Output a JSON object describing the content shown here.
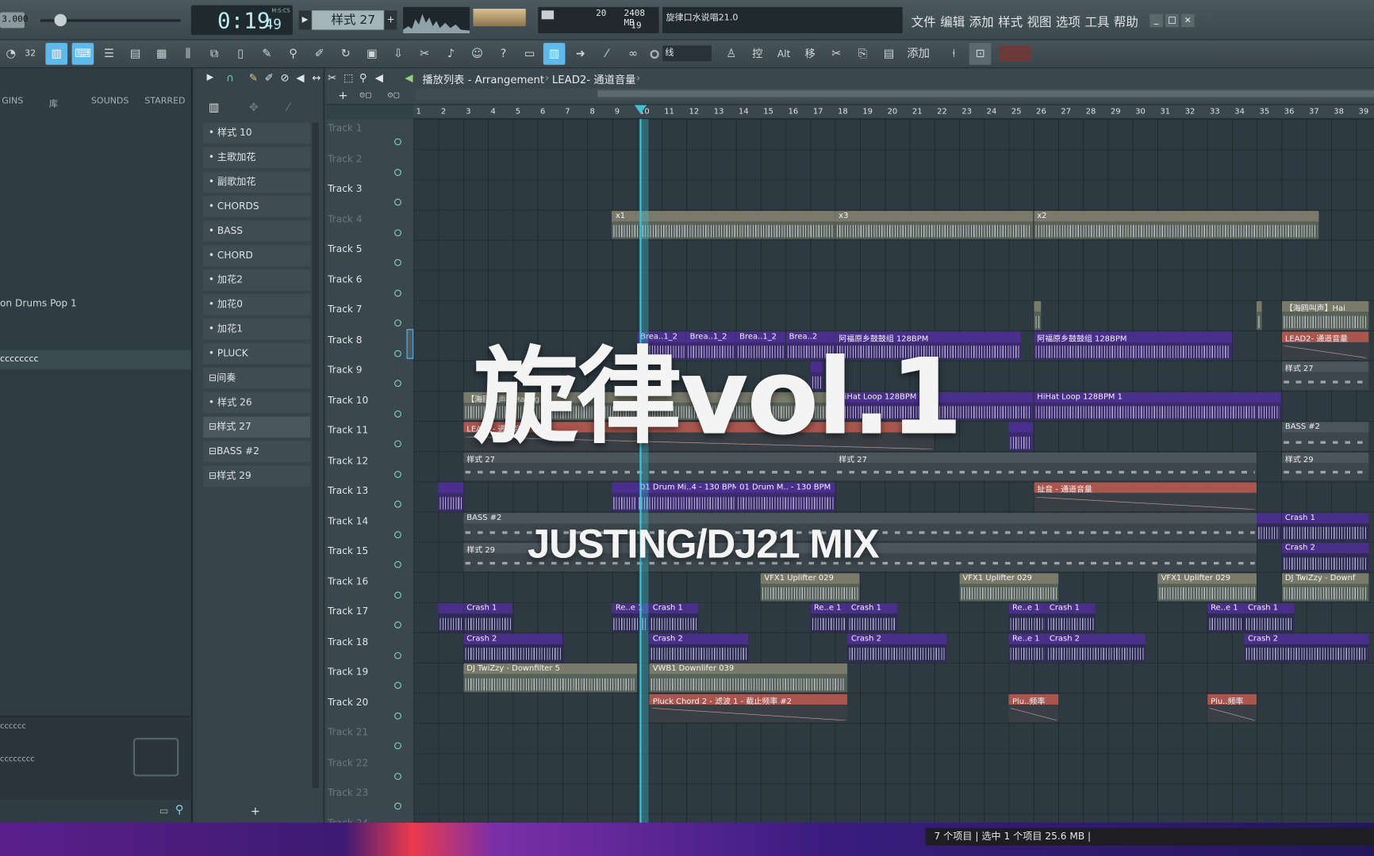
{
  "transport": {
    "pitch": "3.000",
    "time_main": "0:19",
    "time_sub": "49",
    "time_unit": "M:S:CS",
    "pattern": "样式 27"
  },
  "stats": {
    "cpu": "20",
    "ram": "2408 MB",
    "poly": "19"
  },
  "hint": "旋律口水说唱21.0",
  "menu": [
    "文件",
    "编辑",
    "添加",
    "样式",
    "视图",
    "选项",
    "工具",
    "帮助"
  ],
  "window_buttons": [
    "_",
    "□",
    "×"
  ],
  "toolbar": {
    "snap_label": "线",
    "icons": [
      "loop-icon",
      "counter-icon",
      "pattern-song-icon",
      "typing-icon",
      "mixer-icon",
      "channel-rack-icon",
      "playlist-icon",
      "piano-roll-icon",
      "plugin-icon",
      "browser-icon",
      "brush-icon",
      "metronome-icon",
      "pencil-icon",
      "save-icon",
      "render-icon",
      "cut-icon",
      "mic-icon",
      "chat-icon",
      "help-icon"
    ],
    "right_labels": [
      "控",
      "Alt",
      "移",
      "添加"
    ]
  },
  "breadcrumb": {
    "part1": "播放列表 - Arrangement",
    "part2": "LEAD2- 通道音量"
  },
  "browser": {
    "tabs": [
      "GINS",
      "库",
      "SOUNDS",
      "STARRED"
    ],
    "items": [
      {
        "label": "on Drums Pop 1",
        "sel": false
      },
      {
        "label": "cccccccc",
        "sel": true
      }
    ],
    "footer_items": [
      "cccccc",
      "cccccccc"
    ]
  },
  "patterns": [
    "• 样式 10",
    "• 主歌加花",
    "• 副歌加花",
    "• CHORDS",
    "• BASS",
    "• CHORD",
    "• 加花2",
    "• 加花0",
    "• 加花1",
    "• PLUCK",
    "⊟间奏",
    "• 样式 26",
    "⊟样式 27",
    "⊟BASS #2",
    "⊟样式 29"
  ],
  "tracks": [
    {
      "name": "Track 1",
      "dim": true
    },
    {
      "name": "Track 2",
      "dim": true
    },
    {
      "name": "Track 3",
      "dim": false
    },
    {
      "name": "Track 4",
      "dim": true
    },
    {
      "name": "Track 5",
      "dim": false
    },
    {
      "name": "Track 6",
      "dim": false
    },
    {
      "name": "Track 7",
      "dim": false
    },
    {
      "name": "Track 8",
      "dim": false
    },
    {
      "name": "Track 9",
      "dim": false
    },
    {
      "name": "Track 10",
      "dim": false
    },
    {
      "name": "Track 11",
      "dim": false
    },
    {
      "name": "Track 12",
      "dim": false
    },
    {
      "name": "Track 13",
      "dim": false
    },
    {
      "name": "Track 14",
      "dim": false
    },
    {
      "name": "Track 15",
      "dim": false
    },
    {
      "name": "Track 16",
      "dim": false
    },
    {
      "name": "Track 17",
      "dim": false
    },
    {
      "name": "Track 18",
      "dim": false
    },
    {
      "name": "Track 19",
      "dim": false
    },
    {
      "name": "Track 20",
      "dim": false
    },
    {
      "name": "Track 21",
      "dim": true
    },
    {
      "name": "Track 22",
      "dim": true
    },
    {
      "name": "Track 23",
      "dim": true
    },
    {
      "name": "Track 24",
      "dim": true
    }
  ],
  "ruler": [
    "1",
    "2",
    "3",
    "4",
    "5",
    "6",
    "7",
    "8",
    "9",
    "10",
    "11",
    "12",
    "13",
    "14",
    "15",
    "16",
    "17",
    "18",
    "19",
    "20",
    "21",
    "22",
    "23",
    "24",
    "25",
    "26",
    "27",
    "28",
    "29",
    "30",
    "31",
    "32",
    "33",
    "34",
    "35",
    "36",
    "37",
    "38",
    "39"
  ],
  "playhead_bar": 10.1,
  "clips": [
    {
      "t": 4,
      "s": 9.0,
      "e": 18.0,
      "text": "x1",
      "kind": "audio"
    },
    {
      "t": 4,
      "s": 18.0,
      "e": 26.0,
      "text": "x3",
      "kind": "audio"
    },
    {
      "t": 4,
      "s": 26.0,
      "e": 37.5,
      "text": "x2",
      "kind": "audio"
    },
    {
      "t": 7,
      "s": 26.0,
      "e": 26.3,
      "text": "",
      "kind": "audio"
    },
    {
      "t": 7,
      "s": 35.0,
      "e": 35.2,
      "text": "",
      "kind": "audio"
    },
    {
      "t": 7,
      "s": 36.0,
      "e": 39.5,
      "text": "【海鸥叫声】Hai",
      "kind": "audio"
    },
    {
      "t": 8,
      "s": 10.0,
      "e": 12.0,
      "text": "Brea..1_2",
      "kind": "drum"
    },
    {
      "t": 8,
      "s": 12.0,
      "e": 14.0,
      "text": "Brea..1_2",
      "kind": "drum"
    },
    {
      "t": 8,
      "s": 14.0,
      "e": 16.0,
      "text": "Brea..1_2",
      "kind": "drum"
    },
    {
      "t": 8,
      "s": 16.0,
      "e": 18.0,
      "text": "Brea..2",
      "kind": "drum"
    },
    {
      "t": 8,
      "s": 18.0,
      "e": 25.5,
      "text": "阿福原乡鼓鼓组 128BPM",
      "kind": "drum"
    },
    {
      "t": 8,
      "s": 26.0,
      "e": 34.0,
      "text": "阿福原乡鼓鼓组 128BPM",
      "kind": "drum"
    },
    {
      "t": 8,
      "s": 36.0,
      "e": 39.5,
      "text": "LEAD2- 通道音量",
      "kind": "auto"
    },
    {
      "t": 9,
      "s": 17.0,
      "e": 17.5,
      "text": "",
      "kind": "drum"
    },
    {
      "t": 9,
      "s": 36.0,
      "e": 39.5,
      "text": "样式 27",
      "kind": "pattern"
    },
    {
      "t": 10,
      "s": 3.0,
      "e": 18.0,
      "text": "【海鸥叫声】Hai ng",
      "kind": "audio"
    },
    {
      "t": 10,
      "s": 18.0,
      "e": 26.0,
      "text": "HiHat Loop 128BPM 1",
      "kind": "drum"
    },
    {
      "t": 10,
      "s": 26.0,
      "e": 35.0,
      "text": "HiHat Loop 128BPM 1",
      "kind": "drum"
    },
    {
      "t": 10,
      "s": 35.0,
      "e": 36.0,
      "text": "",
      "kind": "drum"
    },
    {
      "t": 11,
      "s": 3.0,
      "e": 22.0,
      "text": "LEAD2- 通道音量",
      "kind": "auto"
    },
    {
      "t": 11,
      "s": 25.0,
      "e": 26.0,
      "text": "",
      "kind": "drum"
    },
    {
      "t": 11,
      "s": 36.0,
      "e": 39.5,
      "text": "BASS #2",
      "kind": "pattern"
    },
    {
      "t": 12,
      "s": 3.0,
      "e": 18.0,
      "text": "样式 27",
      "kind": "pattern"
    },
    {
      "t": 12,
      "s": 18.0,
      "e": 35.0,
      "text": "样式 27",
      "kind": "pattern"
    },
    {
      "t": 12,
      "s": 36.0,
      "e": 39.5,
      "text": "样式 29",
      "kind": "pattern"
    },
    {
      "t": 13,
      "s": 2.0,
      "e": 3.0,
      "text": "",
      "kind": "drum"
    },
    {
      "t": 13,
      "s": 9.0,
      "e": 10.0,
      "text": "",
      "kind": "drum"
    },
    {
      "t": 13,
      "s": 10.0,
      "e": 14.0,
      "text": "01 Drum Mi..4 - 130 BPM",
      "kind": "drum"
    },
    {
      "t": 13,
      "s": 14.0,
      "e": 18.0,
      "text": "01 Drum M.. - 130 BPM",
      "kind": "drum"
    },
    {
      "t": 13,
      "s": 26.0,
      "e": 35.0,
      "text": "扯音 - 通道音量",
      "kind": "auto"
    },
    {
      "t": 14,
      "s": 3.0,
      "e": 35.0,
      "text": "BASS #2",
      "kind": "pattern"
    },
    {
      "t": 14,
      "s": 35.0,
      "e": 36.0,
      "text": "",
      "kind": "crash"
    },
    {
      "t": 14,
      "s": 36.0,
      "e": 39.5,
      "text": "Crash 1",
      "kind": "crash"
    },
    {
      "t": 15,
      "s": 3.0,
      "e": 35.0,
      "text": "样式 29",
      "kind": "pattern"
    },
    {
      "t": 15,
      "s": 36.0,
      "e": 39.5,
      "text": "Crash 2",
      "kind": "crash"
    },
    {
      "t": 16,
      "s": 15.0,
      "e": 19.0,
      "text": "VFX1 Uplifter 029",
      "kind": "audio"
    },
    {
      "t": 16,
      "s": 23.0,
      "e": 27.0,
      "text": "VFX1 Uplifter 029",
      "kind": "audio"
    },
    {
      "t": 16,
      "s": 31.0,
      "e": 35.0,
      "text": "VFX1 Uplifter 029",
      "kind": "audio"
    },
    {
      "t": 16,
      "s": 36.0,
      "e": 39.5,
      "text": "DJ TwiZzy - Downf",
      "kind": "audio"
    },
    {
      "t": 17,
      "s": 2.0,
      "e": 3.0,
      "text": "",
      "kind": "crash"
    },
    {
      "t": 17,
      "s": 3.0,
      "e": 5.0,
      "text": "Crash 1",
      "kind": "crash"
    },
    {
      "t": 17,
      "s": 9.0,
      "e": 10.5,
      "text": "Re..e 1",
      "kind": "crash"
    },
    {
      "t": 17,
      "s": 10.5,
      "e": 12.5,
      "text": "Crash 1",
      "kind": "crash"
    },
    {
      "t": 17,
      "s": 17.0,
      "e": 18.5,
      "text": "Re..e 1",
      "kind": "crash"
    },
    {
      "t": 17,
      "s": 18.5,
      "e": 20.5,
      "text": "Crash 1",
      "kind": "crash"
    },
    {
      "t": 17,
      "s": 25.0,
      "e": 26.5,
      "text": "Re..e 1",
      "kind": "crash"
    },
    {
      "t": 17,
      "s": 26.5,
      "e": 28.5,
      "text": "Crash 1",
      "kind": "crash"
    },
    {
      "t": 17,
      "s": 33.0,
      "e": 34.5,
      "text": "Re..e 1",
      "kind": "crash"
    },
    {
      "t": 17,
      "s": 34.5,
      "e": 36.5,
      "text": "Crash 1",
      "kind": "crash"
    },
    {
      "t": 18,
      "s": 3.0,
      "e": 7.0,
      "text": "Crash 2",
      "kind": "crash"
    },
    {
      "t": 18,
      "s": 10.5,
      "e": 14.5,
      "text": "Crash 2",
      "kind": "crash"
    },
    {
      "t": 18,
      "s": 18.5,
      "e": 22.5,
      "text": "Crash 2",
      "kind": "crash"
    },
    {
      "t": 18,
      "s": 25.0,
      "e": 26.5,
      "text": "Re..e 1",
      "kind": "crash"
    },
    {
      "t": 18,
      "s": 26.5,
      "e": 30.5,
      "text": "Crash 2",
      "kind": "crash"
    },
    {
      "t": 18,
      "s": 34.5,
      "e": 39.5,
      "text": "Crash 2",
      "kind": "crash"
    },
    {
      "t": 19,
      "s": 3.0,
      "e": 10.0,
      "text": "DJ TwiZzy - Downfilter 5",
      "kind": "audio"
    },
    {
      "t": 19,
      "s": 10.5,
      "e": 18.5,
      "text": "VWB1 Downlifer 039",
      "kind": "audio"
    },
    {
      "t": 20,
      "s": 10.5,
      "e": 18.5,
      "text": "Pluck Chord 2 - 滤波 1 - 截止频率 #2",
      "kind": "auto"
    },
    {
      "t": 20,
      "s": 25.0,
      "e": 27.0,
      "text": "Plu..频率",
      "kind": "auto"
    },
    {
      "t": 20,
      "s": 33.0,
      "e": 35.0,
      "text": "Plu..频率",
      "kind": "auto"
    }
  ],
  "overlay": {
    "title": "旋律vol.1",
    "subtitle": "JUSTING/DJ21 MIX"
  },
  "status": {
    "text": "7 个项目  |  选中 1 个项目  25.6 MB  |"
  },
  "colors": {
    "accent": "#5fb9ea",
    "playhead": "#3fc2d8",
    "audio": "#7a7a6a",
    "drum": "#4b2f8e",
    "pattern": "#4a555c",
    "auto": "#a9574e",
    "crash": "#4a2f8a"
  }
}
